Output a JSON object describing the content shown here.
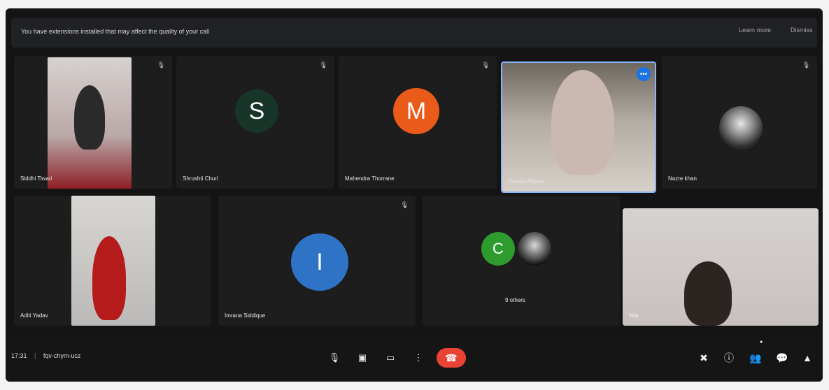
{
  "banner": {
    "text": "You have extensions installed that may affect the quality of your call",
    "learn_more": "Learn more",
    "dismiss": "Dismiss"
  },
  "tiles": {
    "siddhi": "Siddhi Tiwari",
    "shrushti": "Shrushti Churi",
    "mahendra": "Mahendra Thorrane",
    "pavani": "Pavani Anjana",
    "nazre": "Nazre khan",
    "aditi": "Aditi Yadav",
    "imrana": "Imrana Siddique",
    "others": "9 others",
    "you": "You"
  },
  "avatars": {
    "shrushti_initial": "S",
    "mahendra_initial": "M",
    "imrana_initial": "I",
    "others_initial": "C"
  },
  "bottom": {
    "time": "17:31",
    "meeting_code": "fqv-chym-ucz"
  },
  "icons": {
    "mic": "mic-icon",
    "camera": "camera-icon",
    "present": "present-icon",
    "more": "more-icon",
    "end": "end-call-icon",
    "mute": "mute-icon",
    "info": "info-icon",
    "people": "people-icon",
    "chat": "chat-icon",
    "activities": "activities-icon"
  },
  "colors": {
    "accent": "#8ab4f8",
    "end": "#ea4335"
  }
}
